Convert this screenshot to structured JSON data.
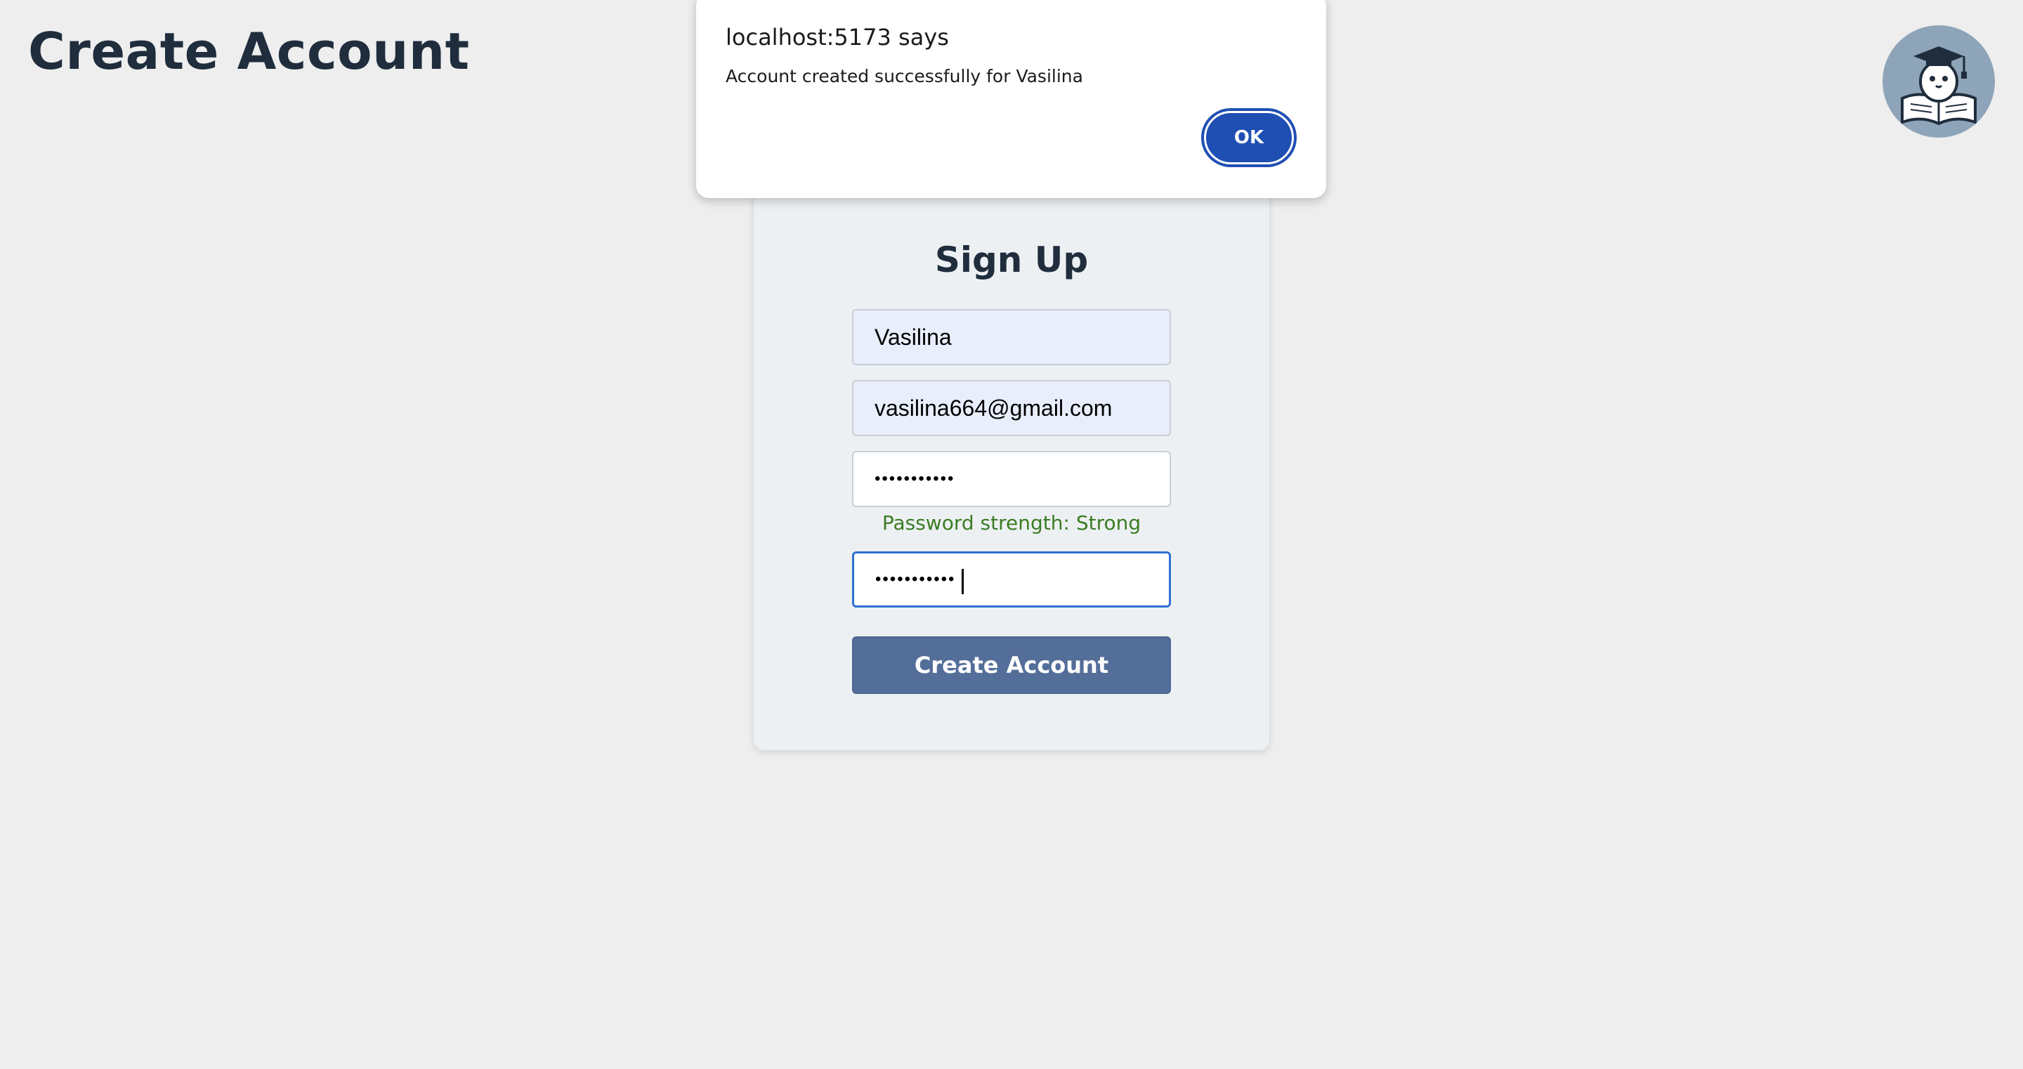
{
  "header": {
    "title": "Create Account"
  },
  "signup": {
    "heading": "Sign Up",
    "name_value": "Vasilina",
    "email_value": "vasilina664@gmail.com",
    "password_value": "•••••••••••",
    "password_strength": "Password strength: Strong",
    "confirm_password_value": "•••••••••••",
    "submit_label": "Create Account"
  },
  "alert": {
    "title": "localhost:5173 says",
    "message": "Account created successfully for Vasilina",
    "ok_label": "OK"
  },
  "colors": {
    "accent": "#1f4fb3",
    "submit_button": "#546e9a",
    "strength_text": "#3a7d22",
    "title_text": "#1f2d3d"
  },
  "icons": {
    "avatar": "graduate-owl-reading-book-icon"
  }
}
